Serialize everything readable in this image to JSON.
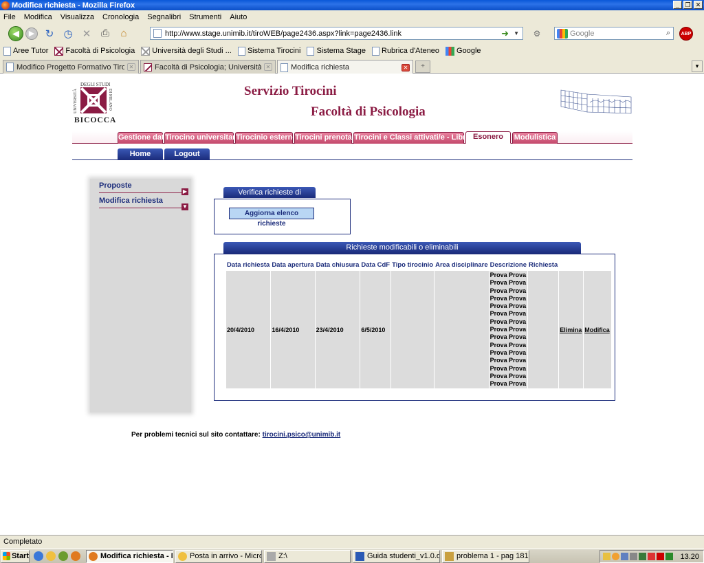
{
  "window": {
    "title": "Modifica richiesta - Mozilla Firefox"
  },
  "menu": [
    "File",
    "Modifica",
    "Visualizza",
    "Cronologia",
    "Segnalibri",
    "Strumenti",
    "Aiuto"
  ],
  "address": {
    "url": "http://www.stage.unimib.it/tiroWEB/page2436.aspx?link=page2436.link"
  },
  "search": {
    "placeholder": "Google"
  },
  "bookmarks": [
    {
      "label": "Aree Tutor",
      "icon": "page-icon"
    },
    {
      "label": "Facoltà di Psicologia",
      "icon": "unimib-icon"
    },
    {
      "label": "Università degli Studi ...",
      "icon": "unimib-grey-icon"
    },
    {
      "label": "Sistema Tirocini",
      "icon": "page-icon"
    },
    {
      "label": "Sistema Stage",
      "icon": "page-icon"
    },
    {
      "label": "Rubrica d'Ateneo",
      "icon": "page-icon"
    },
    {
      "label": "Google",
      "icon": "google-icon"
    }
  ],
  "browser_tabs": [
    {
      "label": "Modifico Progetto Formativo Tirocinio I...",
      "active": false
    },
    {
      "label": "Facoltà di Psicologia; Università di Milan...",
      "active": false
    },
    {
      "label": "Modifica richiesta",
      "active": true
    }
  ],
  "site": {
    "logo": {
      "top": "DEGLI STUDI",
      "side_left": "UNIVERSITÀ",
      "side_right": "DI MILANO",
      "bottom": "BICOCCA"
    },
    "title1": "Servizio Tirocini",
    "title2": "Facoltà di Psicologia"
  },
  "main_nav": [
    "Gestione dati",
    "Tirocino universitario",
    "Tirocinio esterno",
    "Tirocini prenotati",
    "Tirocini e Classi attivati/e - Libretti",
    "Esonero",
    "Modulistica"
  ],
  "sub_nav": [
    "Home",
    "Logout"
  ],
  "sidebar": [
    "Proposte",
    "Modifica richiesta"
  ],
  "verify": {
    "title": "Verifica richieste di esonero",
    "button": "Aggiorna elenco richieste"
  },
  "requests": {
    "title": "Richieste modificabili o eliminabili",
    "headers": [
      "Data richiesta",
      "Data apertura",
      "Data chiusura",
      "Data CdF",
      "Tipo tirocinio",
      "Area disciplinare",
      "Descrizione",
      "Richiesta"
    ],
    "row": {
      "data_richiesta": "20/4/2010",
      "data_apertura": "16/4/2010",
      "data_chiusura": "23/4/2010",
      "data_cdf": "6/5/2010",
      "tipo_tirocinio": "",
      "area_disciplinare": "",
      "descrizione": "Prova Prova\nProva Prova\nProva Prova\nProva Prova\nProva Prova\nProva Prova\nProva Prova\nProva Prova\nProva Prova\nProva Prova\nProva Prova\nProva Prova\nProva Prova\nProva Prova\nProva Prova",
      "richiesta": "",
      "elimina": "Elimina",
      "modifica": "Modifica"
    }
  },
  "footer": {
    "text": "Per problemi tecnici sul sito contattare:",
    "email": "tirocini.psico@unimib.it"
  },
  "status": "Completato",
  "taskbar": {
    "start": "Start",
    "items": [
      {
        "label": "Modifica richiesta - M...",
        "active": true
      },
      {
        "label": "Posta in arrivo - Microsof...",
        "active": false
      },
      {
        "label": "Z:\\",
        "active": false
      },
      {
        "label": "Guida studenti_v1.0.doc...",
        "active": false
      },
      {
        "label": "problema 1 - pag 1817.b...",
        "active": false
      }
    ],
    "clock": "13.20"
  },
  "colors": {
    "brand": "#8b1c44",
    "navy": "#1a2b7a"
  }
}
